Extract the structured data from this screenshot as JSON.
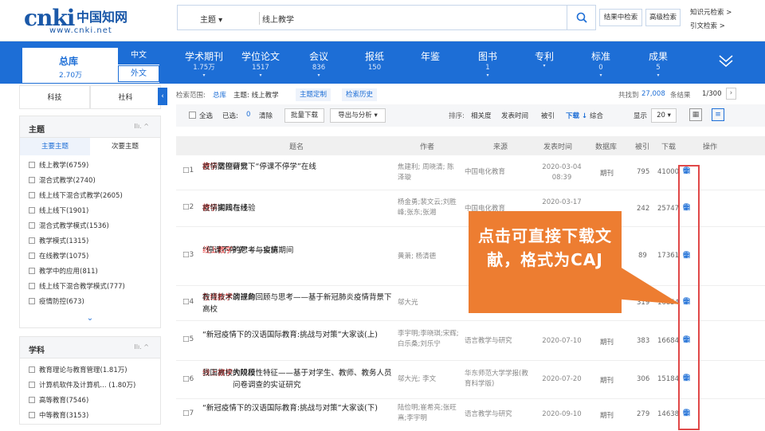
{
  "header": {
    "logo_cn": "中国知网",
    "logo_url": "www.cnki.net",
    "scope": "主题",
    "keyword": "线上教学",
    "btn_result_search": "结果中检索",
    "btn_advanced": "高级检索",
    "link_knowledge": "知识元检索 >",
    "link_citation": "引文检索 >"
  },
  "nav": {
    "total_label": "总库",
    "total_count": "2.70万",
    "lang_cn": "中文",
    "lang_en": "外文",
    "items": [
      {
        "label": "学术期刊",
        "count": "1.75万",
        "caret": "▾"
      },
      {
        "label": "学位论文",
        "count": "1517",
        "caret": "▾"
      },
      {
        "label": "会议",
        "count": "836",
        "caret": "▾"
      },
      {
        "label": "报纸",
        "count": "150",
        "caret": ""
      },
      {
        "label": "年鉴",
        "count": "",
        "caret": ""
      },
      {
        "label": "图书",
        "count": "1",
        "caret": "▾"
      },
      {
        "label": "专利",
        "count": "",
        "caret": "▾"
      },
      {
        "label": "标准",
        "count": "0",
        "caret": "▾"
      },
      {
        "label": "成果",
        "count": "5",
        "caret": "▾"
      }
    ]
  },
  "left": {
    "tab_tech": "科技",
    "tab_social": "社科",
    "subject": {
      "title": "主题",
      "sub_main": "主要主题",
      "sub_second": "次要主题",
      "items": [
        "线上教学(6759)",
        "混合式教学(2740)",
        "线上线下混合式教学(2605)",
        "线上线下(1901)",
        "混合式教学模式(1536)",
        "教学模式(1315)",
        "在线教学(1075)",
        "教学中的应用(811)",
        "线上线下混合教学模式(777)",
        "疫情防控(673)"
      ]
    },
    "discipline": {
      "title": "学科",
      "items": [
        "教育理论与教育管理(1.81万)",
        "计算机软件及计算机... (1.80万)",
        "高等教育(7546)",
        "中等教育(3153)"
      ]
    }
  },
  "main": {
    "scope_label": "检索范围:",
    "scope_db": "总库",
    "scope_kw": "主题: 线上教学",
    "tag_custom": "主题定制",
    "tag_history": "检索历史",
    "found_prefix": "共找到",
    "found_count": "27,008",
    "found_suffix": "条结果",
    "page": "1/300",
    "select_all": "全选",
    "selected_label": "已选:",
    "selected_count": "0",
    "clear": "清除",
    "batch_download": "批量下载",
    "export": "导出与分析 ▾",
    "sort_label": "排序:",
    "sort_options": [
      "相关度",
      "发表时间",
      "被引",
      "下载 ↓",
      "综合"
    ],
    "display_label": "显示",
    "display_count": "20 ▾",
    "columns": [
      "题名",
      "作者",
      "来源",
      "发表时间",
      "数据库",
      "被引",
      "下载",
      "操作"
    ],
    "rows": [
      {
        "n": "1",
        "title_a": "疫情防控背景下“停课不停学”在线",
        "title_hl": "教学",
        "title_b": "案例研究",
        "author": "焦建利; 周晓清; 陈泽璇",
        "source": "中国电化教育",
        "date": "2020-03-04 08:39",
        "db": "期刊",
        "cited": "795",
        "dl": "41000"
      },
      {
        "n": "2",
        "title_a": "疫情期间在线",
        "title_hl": "教学",
        "title_b": "实践与经验",
        "author": "杨金勇;裴文云;刘胜峰;张东;张湘",
        "source": "中国电化教育",
        "date": "2020-03-17",
        "db": "",
        "cited": "242",
        "dl": "25747"
      },
      {
        "n": "3",
        "title_a": "“停课不停学”——疫情期间",
        "title_hl": "线上教学",
        "title_b": "的思考与实施",
        "author": "黄萧; 杨清德",
        "source": "",
        "date": "",
        "db": "",
        "cited": "89",
        "dl": "17361"
      },
      {
        "n": "4",
        "title_a": "教育技术演进的回顾与思考——基于新冠肺炎疫情背景下高校",
        "title_hl": "在线教学",
        "title_b": "的视角",
        "author": "邬大光",
        "source": "",
        "date": "",
        "db": "",
        "cited": "319",
        "dl": "16854"
      },
      {
        "n": "5",
        "title_a": "“新冠疫情下的汉语国际教育:挑战与对策”大家谈(上)",
        "title_hl": "",
        "title_b": "",
        "author": "李宇明;李晓琪;宋辉;白乐桑;刘乐宁",
        "source": "语言教学与研究",
        "date": "2020-07-10",
        "db": "期刊",
        "cited": "383",
        "dl": "16684"
      },
      {
        "n": "6",
        "title_a": "我国高校大规模",
        "title_hl": "线上教学",
        "title_b": "的阶段性特征——基于对学生、教师、教务人员问卷调查的实证研究",
        "author": "邬大光; 李文",
        "source": "华东师范大学学报(教育科学版)",
        "date": "2020-07-20",
        "db": "期刊",
        "cited": "306",
        "dl": "15184"
      },
      {
        "n": "7",
        "title_a": "“新冠疫情下的汉语国际教育:挑战与对策”大家谈(下)",
        "title_hl": "",
        "title_b": "",
        "author": "陆俭明;崔希亮;张旺熹;李宇明",
        "source": "语言教学与研究",
        "date": "2020-09-10",
        "db": "期刊",
        "cited": "279",
        "dl": "14638"
      }
    ],
    "callout": "点击可直接下载文献，格式为CAJ"
  },
  "colors": {
    "brand": "#1d6ed6",
    "callout": "#ed7d31",
    "highlight": "#e02020"
  }
}
